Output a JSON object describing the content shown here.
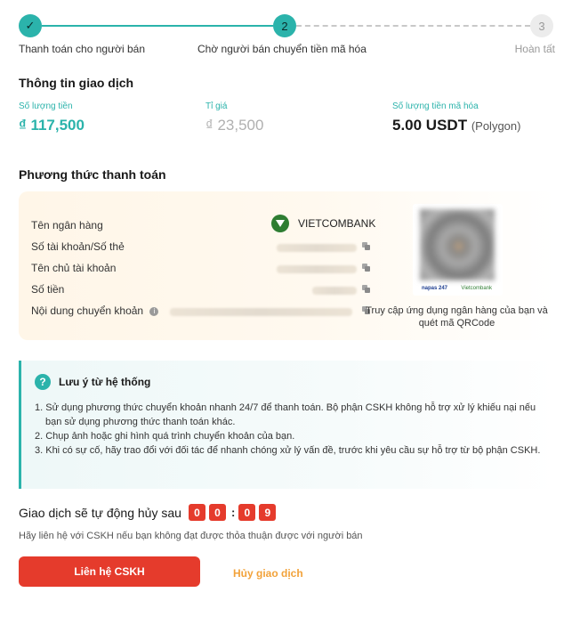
{
  "stepper": {
    "steps": [
      {
        "number": "✓",
        "label": "Thanh toán cho người bán",
        "state": "done"
      },
      {
        "number": "2",
        "label": "Chờ người bán chuyển tiền mã hóa",
        "state": "active"
      },
      {
        "number": "3",
        "label": "Hoàn tất",
        "state": "pending"
      }
    ]
  },
  "transaction": {
    "title": "Thông tin giao dịch",
    "amount_label": "Số lượng tiền",
    "amount_value": "₫ 117,500",
    "rate_label": "Tỉ giá",
    "rate_value": "₫ 23,500",
    "crypto_label": "Số lượng tiền mã hóa",
    "crypto_value": "5.00 USDT",
    "crypto_network": "(Polygon)"
  },
  "payment": {
    "title": "Phương thức thanh toán",
    "bank_name_label": "Tên ngân hàng",
    "bank_name_value": "VIETCOMBANK",
    "account_label": "Số tài khoản/Số thẻ",
    "holder_label": "Tên chủ tài khoản",
    "amount_label": "Số tiền",
    "content_label": "Nội dung chuyển khoản",
    "qr_hint": "Truy cập ứng dụng ngân hàng của bạn và quét mã QRCode",
    "qr_napas": "napas 247",
    "qr_bank": "Vietcombank"
  },
  "notice": {
    "title": "Lưu ý từ hệ thống",
    "items": [
      "1. Sử dụng phương thức chuyển khoản nhanh 24/7 để thanh toán. Bộ phận CSKH không hỗ trợ xử lý khiếu nại nếu bạn sử dụng phương thức thanh toán khác.",
      "2. Chụp ảnh hoặc ghi hình quá trình chuyển khoản của bạn.",
      "3. Khi có sự cố, hãy trao đổi với đối tác để nhanh chóng xử lý vấn đề, trước khi yêu cầu sự hỗ trợ từ bộ phận CSKH."
    ]
  },
  "countdown": {
    "label": "Giao dịch sẽ tự động hủy sau",
    "digits": [
      "0",
      "0",
      "0",
      "9"
    ],
    "separator": ":"
  },
  "contact_note": "Hãy liên hệ với CSKH nếu bạn không đạt được thỏa thuận được với người bán",
  "actions": {
    "contact_label": "Liên hệ CSKH",
    "cancel_label": "Hủy giao dịch"
  },
  "colors": {
    "accent": "#2bb3ab",
    "danger": "#e53b2c",
    "warning_link": "#f2a23a"
  },
  "icons": {
    "step_done": "check-icon",
    "info": "info-icon",
    "copy": "copy-icon",
    "notice": "question-icon",
    "bank": "vietcombank-logo"
  }
}
